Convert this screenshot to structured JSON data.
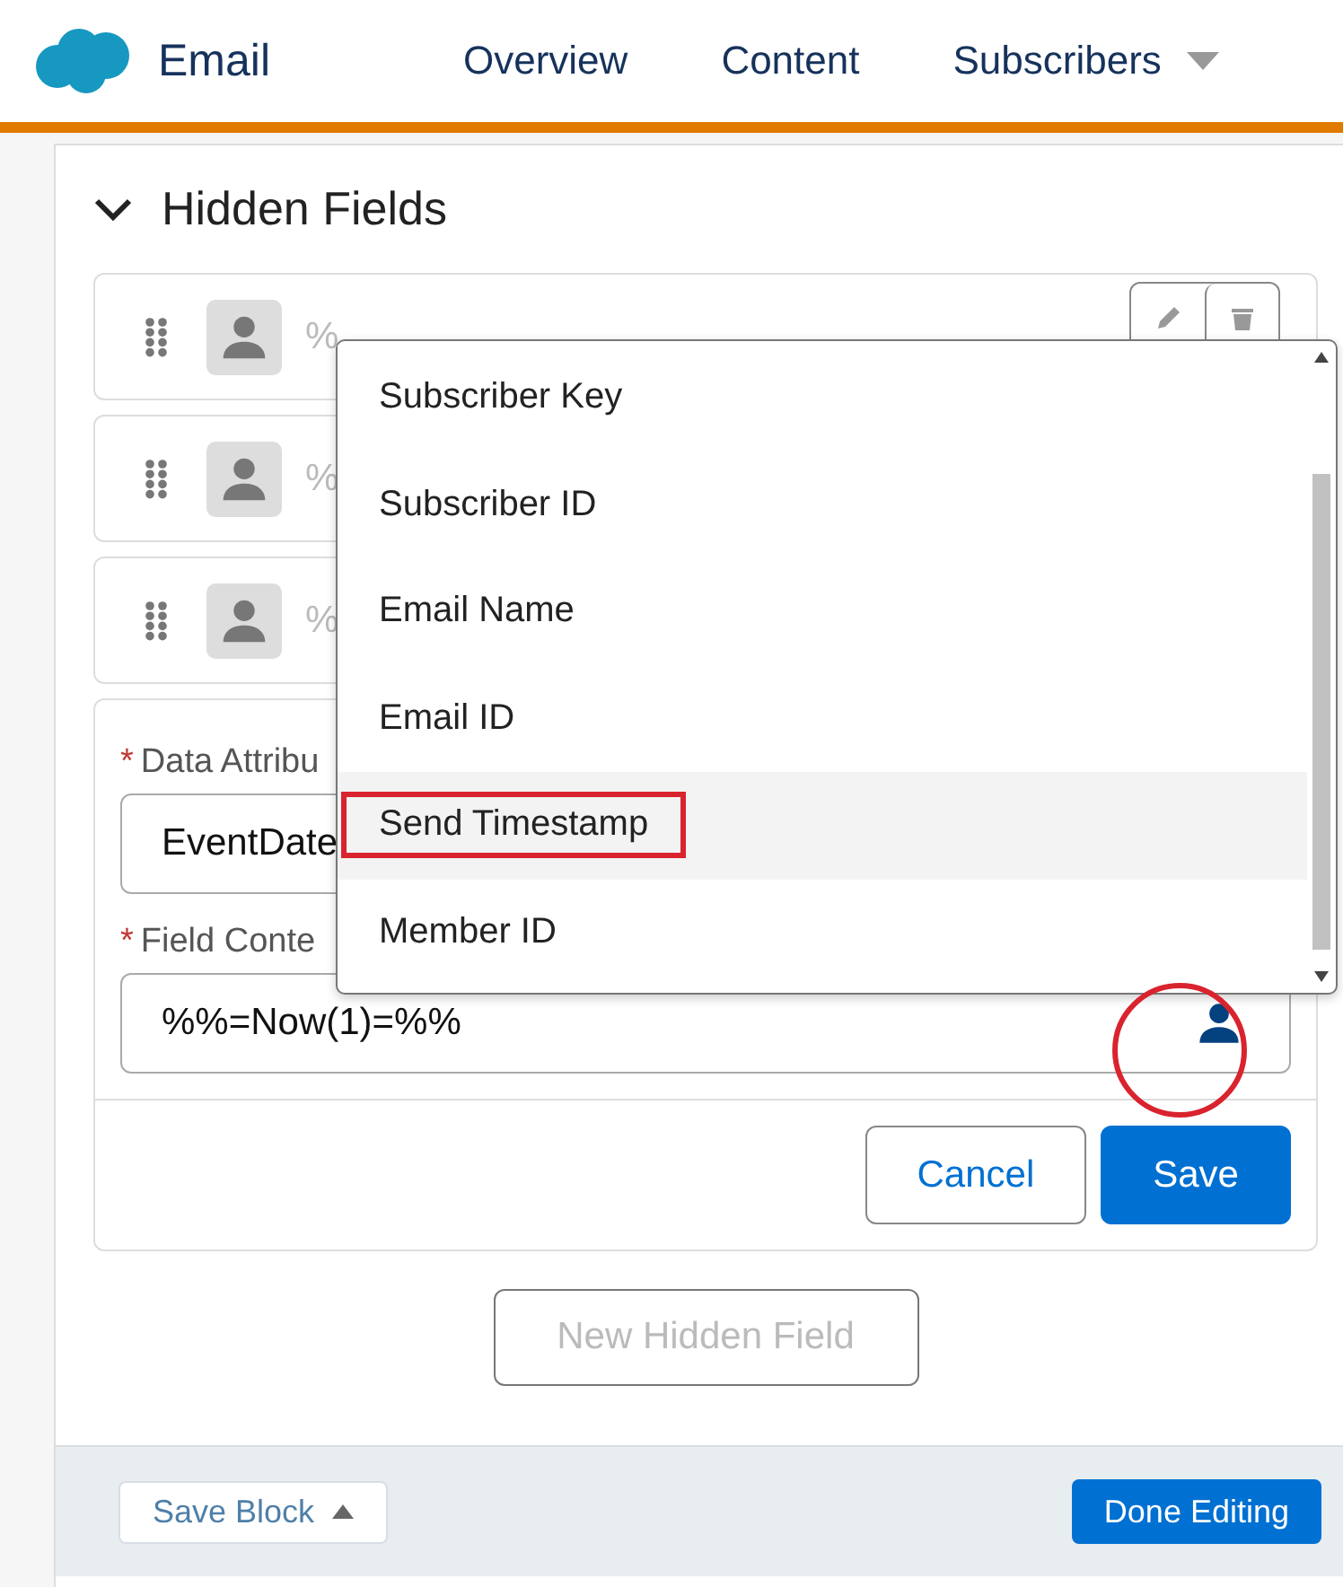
{
  "header": {
    "app_name": "Email",
    "nav": [
      {
        "label": "Overview",
        "dropdown": false
      },
      {
        "label": "Content",
        "dropdown": false
      },
      {
        "label": "Subscribers",
        "dropdown": true
      }
    ]
  },
  "section": {
    "title": "Hidden Fields",
    "expanded": true
  },
  "fields": [
    {
      "value": "%"
    },
    {
      "value": "%"
    },
    {
      "value": "%"
    }
  ],
  "editor": {
    "required_mark": "*",
    "attribute_label": "Data Attribu",
    "attribute_value": "EventDate",
    "content_label": "Field Conte",
    "content_value": "%%=Now(1)=%%",
    "cancel": "Cancel",
    "save": "Save"
  },
  "dropdown": {
    "items": [
      {
        "label": "Subscriber Key",
        "selected": false,
        "highlighted": false
      },
      {
        "label": "Subscriber ID",
        "selected": false,
        "highlighted": false
      },
      {
        "label": "Email Name",
        "selected": false,
        "highlighted": false
      },
      {
        "label": "Email ID",
        "selected": false,
        "highlighted": false
      },
      {
        "label": "Send Timestamp",
        "selected": true,
        "highlighted": true
      },
      {
        "label": "Member ID",
        "selected": false,
        "highlighted": false
      }
    ]
  },
  "new_field_button": {
    "label": "New Hidden Field",
    "disabled": true
  },
  "footer": {
    "save_block": "Save Block",
    "done": "Done Editing"
  }
}
